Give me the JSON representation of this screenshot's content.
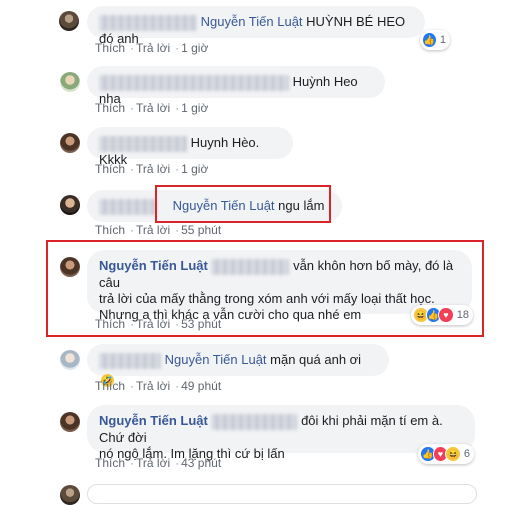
{
  "actions": {
    "like": "Thích",
    "reply": "Trả lời",
    "sep": "·"
  },
  "comments": [
    {
      "mention": "Nguyễn Tiến Luật",
      "text": "HUỲNH BÉ HEO đó anh",
      "time": "1 giờ",
      "reaction_count": "1"
    },
    {
      "text": "Huỳnh Heo nha",
      "time": "1 giờ"
    },
    {
      "text": "Huynh Hèo. Kkkk",
      "time": "1 giờ"
    },
    {
      "mention": "Nguyễn Tiến Luật",
      "text": "ngu lắm",
      "time": "55 phút"
    },
    {
      "name": "Nguyễn Tiến Luật",
      "text_line1": "vẫn khôn hơn bố mày, đó là câu",
      "text_line2": "trả lời của mấy thằng trong xóm anh với mấy loại thất học.",
      "text_line3": "Nhưng a thì khác a vẫn cười cho qua nhé em",
      "time": "53 phút",
      "reaction_count": "18"
    },
    {
      "mention": "Nguyễn Tiến Luật",
      "text": "mặn quá anh ơi",
      "emoji": "🤣",
      "time": "49 phút"
    },
    {
      "name": "Nguyễn Tiến Luật",
      "text_line1": "đôi khi phải mặn tí em à. Chứ đời",
      "text_line2": "nó ngộ lắm. Im lặng thì cứ bị lấn",
      "time": "43 phút",
      "reaction_count": "6"
    }
  ],
  "colors": {
    "highlight": "#d9252a",
    "name": "#385898",
    "bubble": "#f2f3f5"
  }
}
